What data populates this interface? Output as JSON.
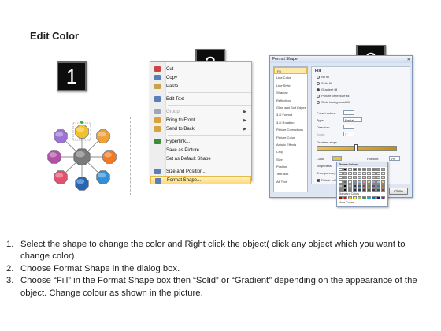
{
  "title": "Edit Color",
  "steps": [
    "1",
    "2",
    "3"
  ],
  "context_menu": {
    "items": [
      {
        "label": "Cut",
        "icon": "scissors-icon",
        "color": "#c44"
      },
      {
        "label": "Copy",
        "icon": "copy-icon",
        "color": "#5a7fb8"
      },
      {
        "label": "Paste",
        "icon": "paste-icon",
        "color": "#c9a14a"
      },
      {
        "label": "Edit Text",
        "icon": "edit-text-icon",
        "color": "#5a7fb8"
      },
      {
        "label": "Group",
        "icon": "group-icon",
        "color": "#9aa7b8",
        "disabled": true,
        "submenu": true
      },
      {
        "label": "Bring to Front",
        "icon": "bring-front-icon",
        "color": "#d9a23a",
        "submenu": true
      },
      {
        "label": "Send to Back",
        "icon": "send-back-icon",
        "color": "#d9a23a",
        "submenu": true
      },
      {
        "label": "Hyperlink...",
        "icon": "hyperlink-icon",
        "color": "#3c8a3c"
      },
      {
        "label": "Save as Picture...",
        "icon": "",
        "color": ""
      },
      {
        "label": "Set as Default Shape",
        "icon": "",
        "color": ""
      },
      {
        "label": "Size and Position...",
        "icon": "size-position-icon",
        "color": "#5a7fb8"
      },
      {
        "label": "Format Shape...",
        "icon": "format-shape-icon",
        "color": "#5a7fb8",
        "highlighted": true
      }
    ]
  },
  "dialog": {
    "title": "Format Shape",
    "close_glyph": "✕",
    "categories": [
      "Fill",
      "Line Color",
      "Line Style",
      "Shadow",
      "Reflection",
      "Glow and Soft Edges",
      "3-D Format",
      "3-D Rotation",
      "Picture Corrections",
      "Picture Color",
      "Artistic Effects",
      "Crop",
      "Size",
      "Position",
      "Text Box",
      "Alt Text"
    ],
    "fill_heading": "Fill",
    "fill_options": [
      "No fill",
      "Solid fill",
      "Gradient fill",
      "Picture or texture fill",
      "Slide background fill"
    ],
    "fill_selected": 2,
    "preset_label": "Preset colors:",
    "type_label": "Type:",
    "type_value": "Radial",
    "direction_label": "Direction:",
    "angle_label": "Angle:",
    "angle_value": "0°",
    "gradient_stops_label": "Gradient stops",
    "color_label": "Color",
    "position_label": "Position:",
    "position_value": "0%",
    "brightness_label": "Brightness:",
    "transparency_label": "Transparency:",
    "rotate_label": "Rotate with shape",
    "close_button": "Close"
  },
  "palette": {
    "theme_title": "Theme Colors",
    "standard_title": "Standard Colors",
    "more_label": "More Colors...",
    "theme_colors": [
      "#ffffff",
      "#000000",
      "#eeece1",
      "#1f497d",
      "#4f81bd",
      "#c0504d",
      "#9bbb59",
      "#8064a2",
      "#4bacc6",
      "#f79646"
    ],
    "standard_colors": [
      "#c00000",
      "#ff0000",
      "#ffc000",
      "#ffff00",
      "#92d050",
      "#00b050",
      "#00b0f0",
      "#0070c0",
      "#002060",
      "#7030a0"
    ]
  },
  "shape_colors": {
    "center": "#7a7a7a",
    "top": "#f2c12e",
    "top_right": "#f0a23a",
    "right": "#f37a22",
    "bottom_right": "#2f8fd8",
    "bottom": "#2566b5",
    "bottom_left": "#e4506e",
    "left": "#b050a6",
    "top_left": "#9a73d3"
  },
  "instructions": [
    {
      "num": "1.",
      "text": "Select the shape to change the color and Right click the object( click any object which you want to change color)"
    },
    {
      "num": "2.",
      "text": "Choose Format Shape in the dialog box."
    },
    {
      "num": "3.",
      "text": "Choose “Fill” in the Format Shape box then “Solid” or “Gradient” depending on the appearance of the object. Change colour as shown in the picture."
    }
  ]
}
